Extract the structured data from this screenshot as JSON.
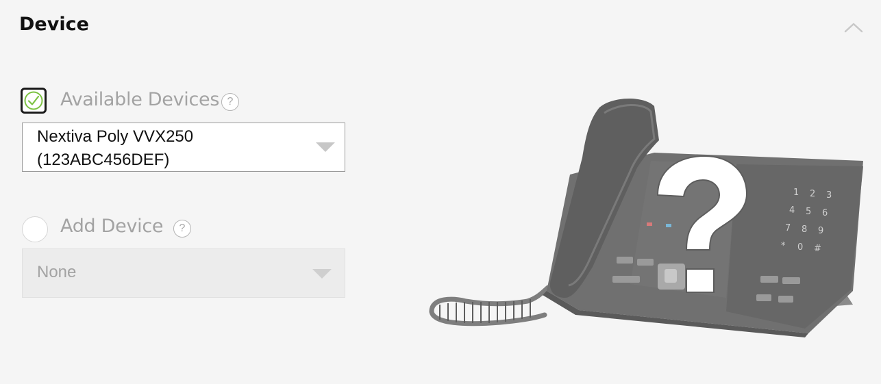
{
  "section": {
    "title": "Device"
  },
  "available_devices": {
    "checked": true,
    "label": "Available Devices",
    "help": "?",
    "selected_line1": "Nextiva Poly VVX250",
    "selected_line2": "(123ABC456DEF)"
  },
  "add_device": {
    "checked": false,
    "label": "Add Device",
    "help": "?",
    "selected": "None",
    "disabled": true
  },
  "icons": {
    "collapse": "chevron-up-icon",
    "check": "checkmark-icon",
    "help": "question-circle-icon",
    "dropdown": "caret-down-icon",
    "illustration": "desk-phone-question-illustration"
  },
  "colors": {
    "background": "#f5f5f5",
    "check_accent": "#7cc242",
    "muted_text": "#a3a3a3"
  }
}
